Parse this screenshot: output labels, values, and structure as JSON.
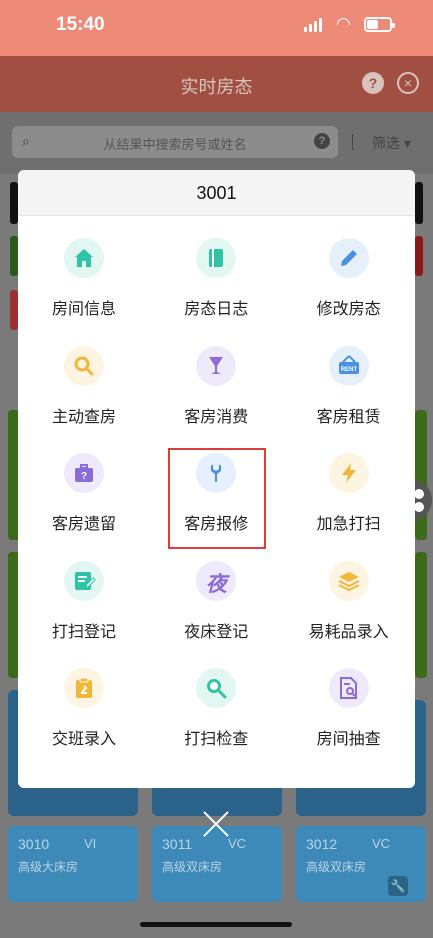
{
  "status_bar": {
    "time": "15:40"
  },
  "header": {
    "title": "实时房态",
    "help_symbol": "?",
    "close_symbol": "×"
  },
  "search": {
    "placeholder": "从结果中搜索房号或姓名",
    "help_symbol": "?",
    "filter_label": "筛选",
    "filter_arrow": "▾"
  },
  "dialog": {
    "room_number": "3001",
    "actions": [
      {
        "label": "房间信息",
        "icon": "home-icon",
        "color": "#2ec4a8",
        "bg": "#e2f7f2"
      },
      {
        "label": "房态日志",
        "icon": "book-icon",
        "color": "#2ec4a8",
        "bg": "#e2f7f2"
      },
      {
        "label": "修改房态",
        "icon": "pencil-icon",
        "color": "#4a90e2",
        "bg": "#e6f0fc"
      },
      {
        "label": "主动查房",
        "icon": "magnifier-icon",
        "color": "#f2b63a",
        "bg": "#fdf4e1"
      },
      {
        "label": "客房消费",
        "icon": "goblet-icon",
        "color": "#8b6bd9",
        "bg": "#efeafb"
      },
      {
        "label": "客房租赁",
        "icon": "rent-sign-icon",
        "color": "#4a90e2",
        "bg": "#e6f0fc"
      },
      {
        "label": "客房遗留",
        "icon": "briefcase-icon",
        "color": "#8b6bd9",
        "bg": "#efeafb"
      },
      {
        "label": "客房报修",
        "icon": "wrench-icon",
        "color": "#4a90e2",
        "bg": "#e6f0fc"
      },
      {
        "label": "加急打扫",
        "icon": "lightning-icon",
        "color": "#f2b63a",
        "bg": "#fdf4e1"
      },
      {
        "label": "打扫登记",
        "icon": "edit-form-icon",
        "color": "#2ec4a8",
        "bg": "#e2f7f2"
      },
      {
        "label": "夜床登记",
        "icon": "night-char-icon",
        "color": "#8b6bd9",
        "bg": "#efeafb",
        "glyph": "夜"
      },
      {
        "label": "易耗品录入",
        "icon": "layers-icon",
        "color": "#f2b63a",
        "bg": "#fdf4e1"
      },
      {
        "label": "交班录入",
        "icon": "clipboard-icon",
        "color": "#f2b63a",
        "bg": "#fdf4e1"
      },
      {
        "label": "打扫检查",
        "icon": "search-check-icon",
        "color": "#2ec4a8",
        "bg": "#e2f7f2"
      },
      {
        "label": "房间抽查",
        "icon": "document-search-icon",
        "color": "#8b6bd9",
        "bg": "#efeafb"
      }
    ]
  },
  "rooms": [
    {
      "number": "3010",
      "code": "VI",
      "type": "高级大床房"
    },
    {
      "number": "3011",
      "code": "VC",
      "type": "高级双床房"
    },
    {
      "number": "3012",
      "code": "VC",
      "type": "高级双床房"
    }
  ],
  "colors": {
    "status_bar": "#ee8a78",
    "header": "#a14f42",
    "highlight": "#e03a3a",
    "room_card": "#3d8ab8"
  }
}
